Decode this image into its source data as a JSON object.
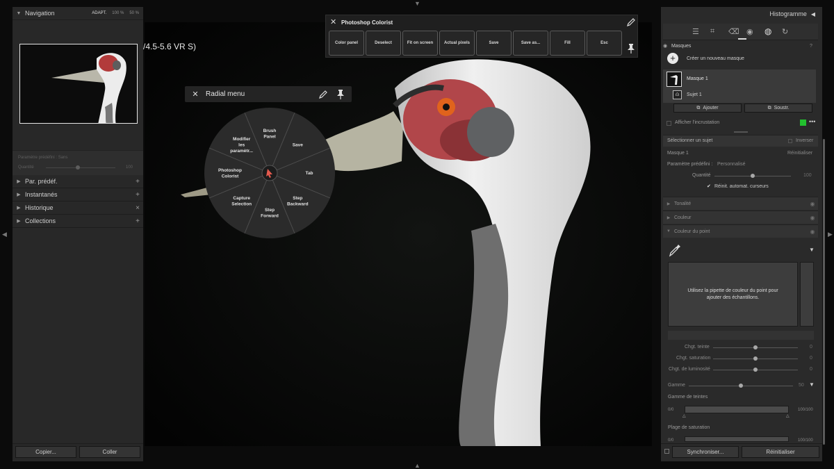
{
  "navigator": {
    "title": "Navigation",
    "zoom_options": [
      "ADAPT.",
      "100 %",
      "50 %"
    ]
  },
  "left_panels": {
    "faded_preset": {
      "label": "Paramètre prédéfini : Sans",
      "amount_label": "Quantité",
      "amount_value": "100"
    },
    "sections": [
      {
        "label": "Par. prédéf.",
        "action": "+"
      },
      {
        "label": "Instantanés",
        "action": "+"
      },
      {
        "label": "Historique",
        "action": "×"
      },
      {
        "label": "Collections",
        "action": "+"
      }
    ],
    "copy_label": "Copier...",
    "paste_label": "Coller"
  },
  "photo": {
    "lens_text": "/4.5-5.6 VR S)"
  },
  "colorist": {
    "title": "Photoshop Colorist",
    "buttons": [
      "Color panel",
      "Deselect",
      "Fit on screen",
      "Actual pixels",
      "Save",
      "Save as...",
      "Fill",
      "Esc"
    ]
  },
  "radial_menu": {
    "title": "Radial menu",
    "segments": [
      "Brush Panel",
      "Save",
      "Tab",
      "Step Backward",
      "Step Forward",
      "Capture Selection",
      "Photoshop Colorist",
      "Modifier les paramètr..."
    ]
  },
  "right_panel": {
    "histogram_title": "Histogramme",
    "masks_title": "Masques",
    "create_mask_label": "Créer un nouveau masque",
    "mask_name": "Masque 1",
    "subject_name": "Sujet 1",
    "add_label": "Ajouter",
    "subtract_label": "Soustr.",
    "show_overlay_label": "Afficher l'incrustation",
    "overlay_color": "#22c02e",
    "select_subject_label": "Sélectionner un sujet",
    "invert_label": "Inverser",
    "mask_section_label": "Masque 1",
    "reset_label": "Réinitialiser",
    "preset_label": "Paramètre prédéfini :",
    "preset_value": "Personnalisé",
    "amount_label": "Quantité",
    "amount_value": "100",
    "auto_reset_label": "Réinit. automat. curseurs",
    "sections": [
      "Tonalité",
      "Couleur",
      "Couleur du point"
    ],
    "point_color_hint": "Utilisez la pipette de couleur du point pour ajouter des échantillons.",
    "sliders": [
      {
        "label": "Chgt. teinte",
        "value": "0"
      },
      {
        "label": "Chgt. saturation",
        "value": "0"
      },
      {
        "label": "Chgt. de luminosité",
        "value": "0"
      }
    ],
    "range_label": "Gamme",
    "range_value": "50",
    "hue_range_label": "Gamme de teintes",
    "hue_range_min": "0/0",
    "hue_range_max": "100/100",
    "sat_range_label": "Plage de saturation",
    "sat_range_min": "0/0",
    "sat_range_max": "100/100",
    "sync_label": "Synchroniser...",
    "reset_all_label": "Réinitialiser"
  }
}
